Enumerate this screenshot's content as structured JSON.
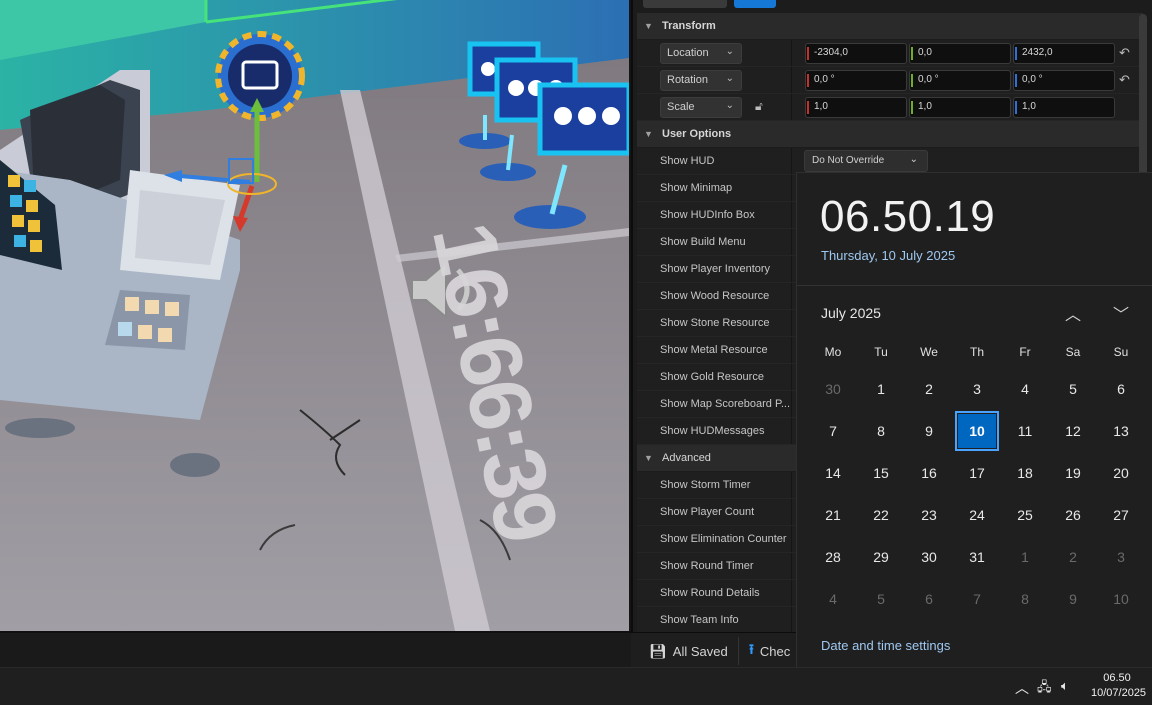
{
  "viewport": {
    "floor_text": "16:66:39"
  },
  "details": {
    "transform": {
      "title": "Transform",
      "rows": [
        {
          "label": "Location",
          "x": "-2304,0",
          "y": "0,0",
          "z": "2432,0"
        },
        {
          "label": "Rotation",
          "x": "0,0 °",
          "y": "0,0 °",
          "z": "0,0 °"
        },
        {
          "label": "Scale",
          "x": "1,0",
          "y": "1,0",
          "z": "1,0"
        }
      ]
    },
    "user_options": {
      "title": "User Options",
      "rows": [
        "Show HUD",
        "Show Minimap",
        "Show HUDInfo Box",
        "Show Build Menu",
        "Show Player Inventory",
        "Show Wood Resource",
        "Show Stone Resource",
        "Show Metal Resource",
        "Show Gold Resource",
        "Show Map Scoreboard P...",
        "Show HUDMessages"
      ],
      "hud_value": "Do Not Override"
    },
    "advanced": {
      "title": "Advanced",
      "rows": [
        "Show Storm Timer",
        "Show Player Count",
        "Show Elimination Counter",
        "Show Round Timer",
        "Show Round Details",
        "Show Team Info"
      ]
    }
  },
  "statusbar": {
    "all_saved": "All Saved",
    "check": "Chec"
  },
  "calendar": {
    "time": "06.50.19",
    "long_date": "Thursday, 10 July 2025",
    "month": "July 2025",
    "weekdays": [
      "Mo",
      "Tu",
      "We",
      "Th",
      "Fr",
      "Sa",
      "Su"
    ],
    "weeks": [
      [
        "30",
        "1",
        "2",
        "3",
        "4",
        "5",
        "6"
      ],
      [
        "7",
        "8",
        "9",
        "10",
        "11",
        "12",
        "13"
      ],
      [
        "14",
        "15",
        "16",
        "17",
        "18",
        "19",
        "20"
      ],
      [
        "21",
        "22",
        "23",
        "24",
        "25",
        "26",
        "27"
      ],
      [
        "28",
        "29",
        "30",
        "31",
        "1",
        "2",
        "3"
      ],
      [
        "4",
        "5",
        "6",
        "7",
        "8",
        "9",
        "10"
      ]
    ],
    "settings_link": "Date and time settings",
    "accent": "#0067c0"
  },
  "taskbar": {
    "time": "06.50",
    "date": "10/07/2025"
  }
}
